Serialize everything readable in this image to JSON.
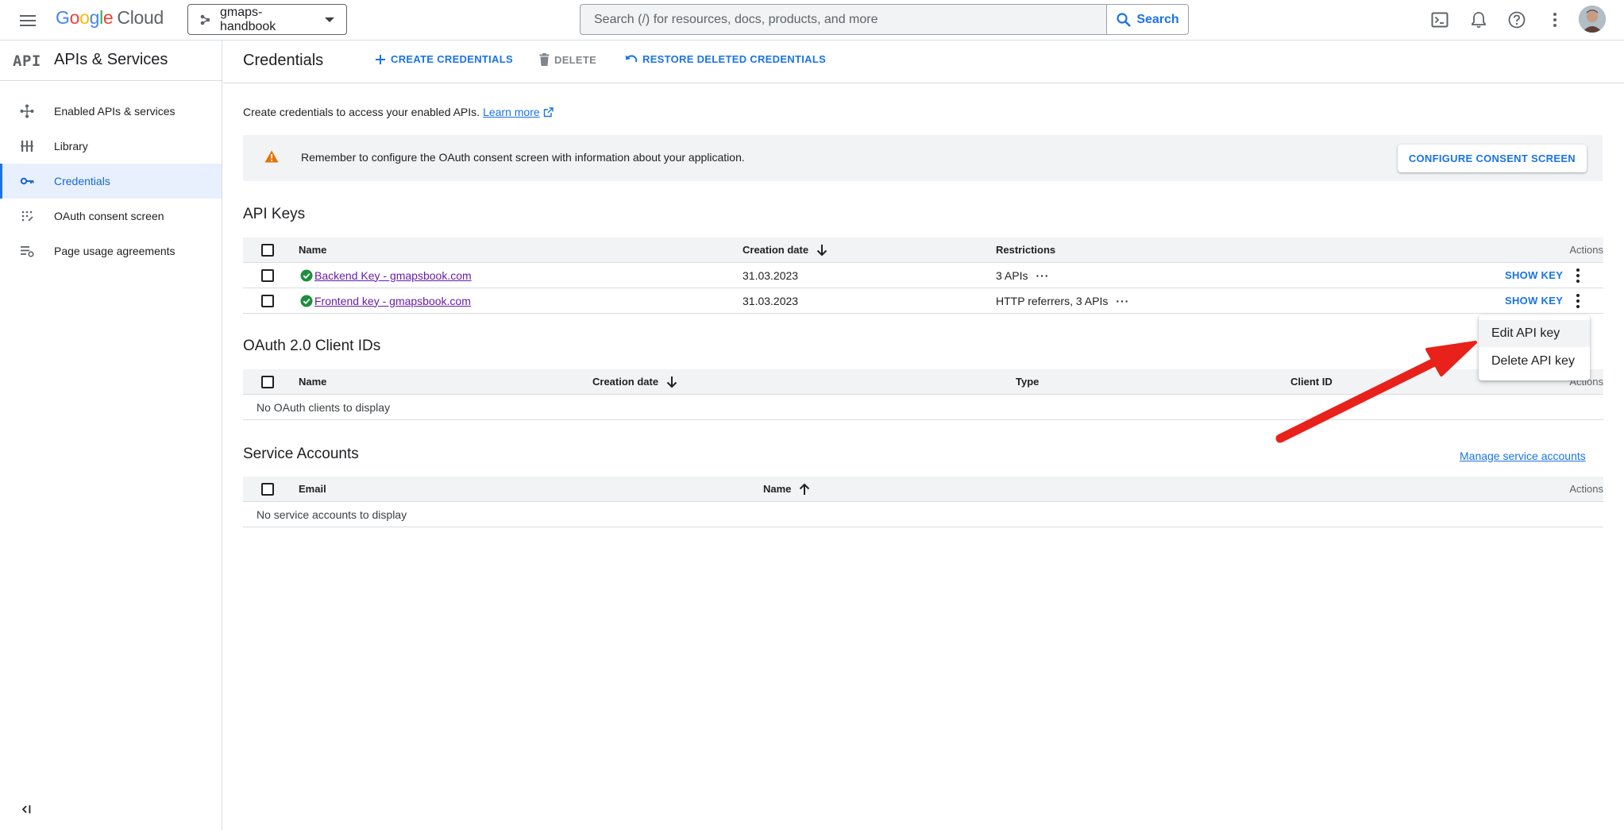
{
  "topbar": {
    "logo_parts": [
      "G",
      "o",
      "o",
      "g",
      "l",
      "e"
    ],
    "logo_suffix": "Cloud",
    "project_name": "gmaps-handbook",
    "search_placeholder": "Search (/) for resources, docs, products, and more",
    "search_button": "Search",
    "icons": [
      "menu-icon",
      "project-icon",
      "caret-down-icon",
      "search-icon",
      "terminal-icon",
      "bell-icon",
      "help-icon",
      "more-vert-icon"
    ]
  },
  "sidebar": {
    "logo_text": "API",
    "title": "APIs & Services",
    "items": [
      {
        "label": "Enabled APIs & services",
        "icon": "enabled-apis-icon",
        "active": false
      },
      {
        "label": "Library",
        "icon": "library-icon",
        "active": false
      },
      {
        "label": "Credentials",
        "icon": "key-icon",
        "active": true
      },
      {
        "label": "OAuth consent screen",
        "icon": "oauth-icon",
        "active": false
      },
      {
        "label": "Page usage agreements",
        "icon": "agreements-icon",
        "active": false
      }
    ]
  },
  "header": {
    "title": "Credentials",
    "create": "CREATE CREDENTIALS",
    "delete": "DELETE",
    "restore": "RESTORE DELETED CREDENTIALS"
  },
  "intro": {
    "text": "Create credentials to access your enabled APIs.",
    "link": "Learn more"
  },
  "banner": {
    "message": "Remember to configure the OAuth consent screen with information about your application.",
    "button": "CONFIGURE CONSENT SCREEN"
  },
  "api_keys": {
    "title": "API Keys",
    "columns": {
      "name": "Name",
      "created": "Creation date",
      "restrictions": "Restrictions",
      "actions": "Actions"
    },
    "rows": [
      {
        "name": "Backend Key - gmapsbook.com",
        "created": "31.03.2023",
        "restrictions": "3 APIs",
        "action": "SHOW KEY"
      },
      {
        "name": "Frontend key - gmapsbook.com",
        "created": "31.03.2023",
        "restrictions": "HTTP referrers, 3 APIs",
        "action": "SHOW KEY"
      }
    ]
  },
  "oauth": {
    "title": "OAuth 2.0 Client IDs",
    "columns": {
      "name": "Name",
      "created": "Creation date",
      "type": "Type",
      "client_id": "Client ID",
      "actions": "Actions"
    },
    "empty": "No OAuth clients to display"
  },
  "service_accounts": {
    "title": "Service Accounts",
    "manage_link": "Manage service accounts",
    "columns": {
      "email": "Email",
      "name": "Name",
      "actions": "Actions"
    },
    "empty": "No service accounts to display"
  },
  "context_menu": {
    "items": [
      "Edit API key",
      "Delete API key"
    ]
  },
  "colors": {
    "accent": "#1a73e8",
    "visited_link": "#681da8",
    "warning": "#e37400",
    "success": "#1e8e3e",
    "annotation_arrow": "#e8211a"
  }
}
